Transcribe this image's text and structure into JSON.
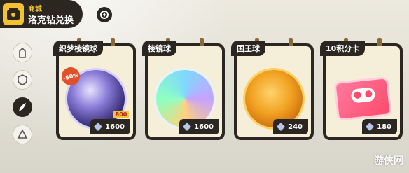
{
  "header": {
    "subtitle": "商城",
    "title": "洛克钻兑换"
  },
  "sidebar": {
    "items": [
      {
        "name": "tower-icon"
      },
      {
        "name": "shield-icon"
      },
      {
        "name": "feather-icon",
        "active": true
      },
      {
        "name": "triangle-star-icon"
      }
    ]
  },
  "cards": [
    {
      "name": "织梦棱镜球",
      "discount": "-50%",
      "sale_price": "800",
      "original_price": "1600"
    },
    {
      "name": "棱镜球",
      "price": "1600"
    },
    {
      "name": "国王球",
      "price": "240"
    },
    {
      "name": "10积分卡",
      "price": "180"
    }
  ],
  "colors": {
    "dark": "#2b2621",
    "accent": "#f2c230",
    "card_bg": "#f5efd9"
  },
  "watermark": "游侠网"
}
